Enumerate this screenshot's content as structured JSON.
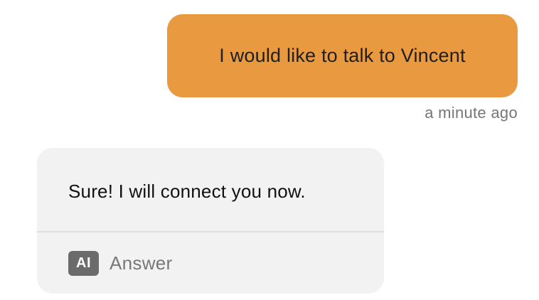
{
  "colors": {
    "user_bubble": "#E99A40",
    "bot_bubble": "#F2F2F2",
    "ai_badge": "#6B6B6B",
    "muted_text": "#767676"
  },
  "messages": {
    "user": {
      "text": "I would like to talk to Vincent",
      "timestamp": "a minute ago"
    },
    "bot": {
      "text": "Sure! I will connect you now.",
      "badge": "AI",
      "label": "Answer"
    }
  }
}
